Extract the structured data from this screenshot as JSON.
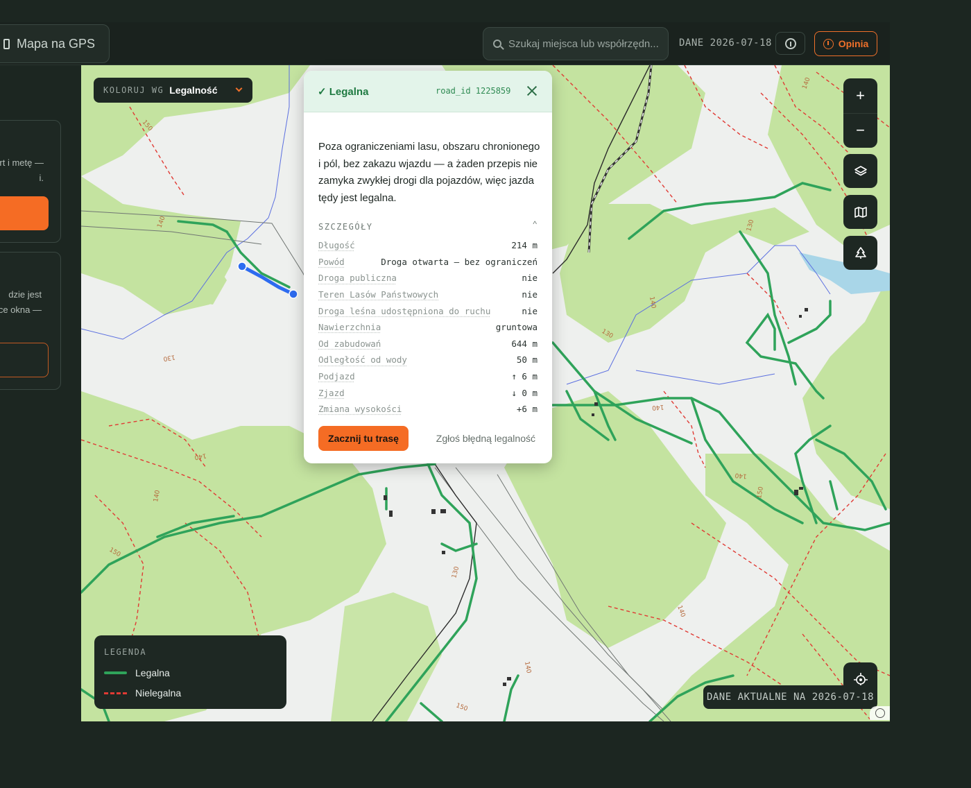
{
  "topbar": {
    "gps_button": "Mapa na GPS",
    "search_placeholder": "Szukaj miejsca lub współrzędn...",
    "data_date": "DANE 2026-07-18",
    "feedback_button": "Opinia"
  },
  "sidebar": {
    "card1_text": [
      "rt i metę —",
      "i."
    ],
    "card2_text": [
      "dzie jest",
      "ce okna —"
    ]
  },
  "map": {
    "color_by_label": "KOLORUJ WG",
    "color_by_value": "Legalność",
    "zoom_in": "+",
    "zoom_out": "−",
    "legend": {
      "title": "LEGENDA",
      "legal": "Legalna",
      "illegal": "Nielegalna"
    },
    "data_current": "DANE AKTUALNE NA 2026-07-18",
    "contour_labels": [
      "150",
      "130",
      "140"
    ]
  },
  "popup": {
    "status": "✓ Legalna",
    "road_id": "road_id 1225859",
    "description": "Poza ograniczeniami lasu, obszaru chronionego i pól, bez zakazu wjazdu — a żaden przepis nie zamyka zwykłej drogi dla pojazdów, więc jazda tędy jest legalna.",
    "details_title": "SZCZEGÓŁY",
    "details_caret": "^",
    "details": [
      {
        "k": "Długość",
        "v": "214 m"
      },
      {
        "k": "Powód",
        "v": "Droga otwarta – bez ograniczeń"
      },
      {
        "k": "Droga publiczna",
        "v": "nie"
      },
      {
        "k": "Teren Lasów Państwowych",
        "v": "nie"
      },
      {
        "k": "Droga leśna udostępniona do ruchu",
        "v": "nie"
      },
      {
        "k": "Nawierzchnia",
        "v": "gruntowa"
      },
      {
        "k": "Od zabudowań",
        "v": "644 m"
      },
      {
        "k": "Odległość od wody",
        "v": "50 m"
      },
      {
        "k": "Podjazd",
        "v": "↑ 6 m"
      },
      {
        "k": "Zjazd",
        "v": "↓ 0 m"
      },
      {
        "k": "Zmiana wysokości",
        "v": "+6 m"
      }
    ],
    "start_button": "Zacznij tu trasę",
    "report_link": "Zgłoś błędną legalność"
  },
  "colors": {
    "accent": "#f56c24",
    "legal": "#2fa35a",
    "illegal": "#e03a34",
    "forest": "#c4e3a0"
  }
}
